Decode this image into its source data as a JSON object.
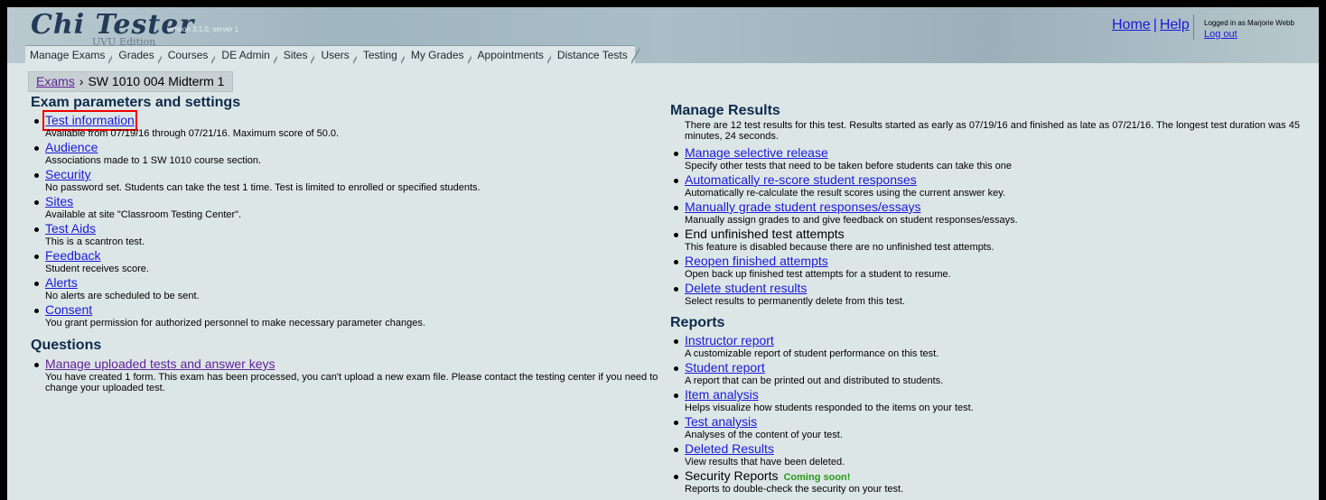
{
  "header": {
    "logo_main": "Chi Tester",
    "logo_version": "version 3.1.0, server 1",
    "logo_edition": "UVU Edition",
    "home_link": "Home",
    "help_link": "Help",
    "separator": "|",
    "logged_in_text": "Logged in as Marjorie Webb",
    "logout_link": "Log out"
  },
  "tabs": [
    {
      "label": "Manage Exams"
    },
    {
      "label": "Grades"
    },
    {
      "label": "Courses"
    },
    {
      "label": "DE Admin"
    },
    {
      "label": "Sites"
    },
    {
      "label": "Users"
    },
    {
      "label": "Testing"
    },
    {
      "label": "My Grades"
    },
    {
      "label": "Appointments"
    },
    {
      "label": "Distance Tests"
    }
  ],
  "breadcrumb": {
    "root": "Exams",
    "arrow": "›",
    "current": "SW 1010 004 Midterm 1"
  },
  "left": {
    "params_heading": "Exam parameters and settings",
    "params": [
      {
        "title": "Test information",
        "desc": "Available from 07/19/16 through 07/21/16. Maximum score of 50.0."
      },
      {
        "title": "Audience",
        "desc": "Associations made to 1 SW 1010 course section."
      },
      {
        "title": "Security",
        "desc": "No password set. Students can take the test 1 time. Test is limited to enrolled or specified students."
      },
      {
        "title": "Sites",
        "desc": "Available at site \"Classroom Testing Center\"."
      },
      {
        "title": "Test Aids",
        "desc": "This is a scantron test."
      },
      {
        "title": "Feedback",
        "desc": "Student receives score."
      },
      {
        "title": "Alerts",
        "desc": "No alerts are scheduled to be sent."
      },
      {
        "title": "Consent",
        "desc": "You grant permission for authorized personnel to make necessary parameter changes."
      }
    ],
    "questions_heading": "Questions",
    "questions": [
      {
        "title": "Manage uploaded tests and answer keys",
        "desc": "You have created 1 form. This exam has been processed, you can't upload a new exam file. Please contact the testing center if you need to change your uploaded test."
      }
    ]
  },
  "right": {
    "results_heading": "Manage Results",
    "results_summary": "There are 12 test results for this test. Results started as early as 07/19/16 and finished as late as 07/21/16. The longest test duration was 45 minutes, 24 seconds.",
    "results": [
      {
        "title": "Manage selective release",
        "desc": "Specify other tests that need to be taken before students can take this one"
      },
      {
        "title": "Automatically re-score student responses",
        "desc": "Automatically re-calculate the result scores using the current answer key."
      },
      {
        "title": "Manually grade student responses/essays",
        "desc": "Manually assign grades to and give feedback on student responses/essays."
      },
      {
        "title": "End unfinished test attempts",
        "desc": "This feature is disabled because there are no unfinished test attempts."
      },
      {
        "title": "Reopen finished attempts",
        "desc": "Open back up finished test attempts for a student to resume."
      },
      {
        "title": "Delete student results",
        "desc": "Select results to permanently delete from this test."
      }
    ],
    "reports_heading": "Reports",
    "reports": [
      {
        "title": "Instructor report",
        "desc": "A customizable report of student performance on this test."
      },
      {
        "title": "Student report",
        "desc": "A report that can be printed out and distributed to students."
      },
      {
        "title": "Item analysis",
        "desc": "Helps visualize how students responded to the items on your test."
      },
      {
        "title": "Test analysis",
        "desc": "Analyses of the content of your test."
      },
      {
        "title": "Deleted Results",
        "desc": "View results that have been deleted."
      },
      {
        "title": "Security Reports",
        "badge": "Coming soon!",
        "desc": "Reports to double-check the security on your test."
      }
    ]
  },
  "colors": {
    "link": "#1a1ad8",
    "visited_link": "#5f239a",
    "heading": "#0c2b4c",
    "highlight_box": "#e00000",
    "coming_soon": "#2a9a1a",
    "page_bg": "#dde6e6"
  }
}
